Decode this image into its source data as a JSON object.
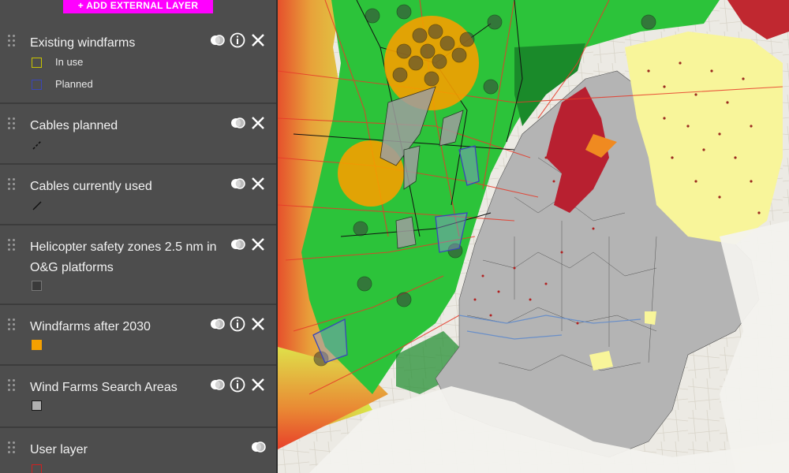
{
  "sidebar": {
    "add_layer_label": "+ ADD EXTERNAL LAYER",
    "layers": [
      {
        "title": "Existing windfarms",
        "has_info": true,
        "legend": [
          {
            "label": "In use",
            "color": "#c8c400",
            "style": "outline"
          },
          {
            "label": "Planned",
            "color": "#3a46b8",
            "style": "outline"
          }
        ]
      },
      {
        "title": "Cables planned",
        "has_info": false,
        "legend": [
          {
            "label": "",
            "color": "#111111",
            "style": "dashed-line"
          }
        ]
      },
      {
        "title": "Cables currently used",
        "has_info": false,
        "legend": [
          {
            "label": "",
            "color": "#111111",
            "style": "line"
          }
        ]
      },
      {
        "title": "Helicopter safety zones 2.5 nm in O&G platforms",
        "has_info": false,
        "legend": [
          {
            "label": "",
            "color": "#3a3a3a",
            "style": "fill"
          }
        ]
      },
      {
        "title": "Windfarms after 2030",
        "has_info": true,
        "legend": [
          {
            "label": "",
            "color": "#f5a000",
            "style": "fill"
          }
        ]
      },
      {
        "title": "Wind Farms Search Areas",
        "has_info": true,
        "legend": [
          {
            "label": "",
            "color": "#b0b0b0",
            "style": "fill"
          }
        ]
      },
      {
        "title": "User layer",
        "has_info": false,
        "legend": [
          {
            "label": "",
            "color": "#d02020",
            "style": "outline"
          }
        ]
      }
    ],
    "icons": {
      "opacity": "opacity-icon",
      "info": "info-icon",
      "remove": "close-icon",
      "drag": "drag-handle-icon"
    }
  },
  "map": {
    "colors": {
      "sea_gradient_outer": "#d8e84a",
      "sea_hot": "#e8502a",
      "eez_green": "#2cc33a",
      "dark_green": "#1a8a2a",
      "windfarm_orange": "#f5a000",
      "search_area_grey": "#9e9e9e",
      "land_grey": "#b4b4b4",
      "bird_yellow": "#f8f59a",
      "natura_red": "#b82030",
      "base_land": "#eceae4"
    }
  }
}
